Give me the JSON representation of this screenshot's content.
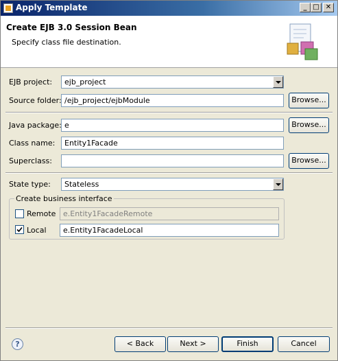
{
  "window": {
    "title": "Apply Template",
    "min_glyph": "_",
    "max_glyph": "□",
    "close_glyph": "✕"
  },
  "banner": {
    "title": "Create EJB 3.0 Session Bean",
    "description": "Specify class file destination.",
    "icon": "wizard-document-icon"
  },
  "form": {
    "ejb_project": {
      "label": "EJB project:",
      "value": "ejb_project"
    },
    "source_folder": {
      "label": "Source folder:",
      "value": "/ejb_project/ejbModule",
      "browse": "Browse..."
    },
    "java_package": {
      "label": "Java package:",
      "value": "e",
      "browse": "Browse..."
    },
    "class_name": {
      "label": "Class name:",
      "value": "Entity1Facade"
    },
    "superclass": {
      "label": "Superclass:",
      "value": "",
      "browse": "Browse..."
    },
    "state_type": {
      "label": "State type:",
      "value": "Stateless"
    }
  },
  "business_interface": {
    "title": "Create business interface",
    "remote": {
      "label": "Remote",
      "checked": false,
      "value": "e.Entity1FacadeRemote"
    },
    "local": {
      "label": "Local",
      "checked": true,
      "value": "e.Entity1FacadeLocal"
    }
  },
  "footer": {
    "help_glyph": "?",
    "back": "< Back",
    "next": "Next >",
    "finish": "Finish",
    "cancel": "Cancel"
  }
}
